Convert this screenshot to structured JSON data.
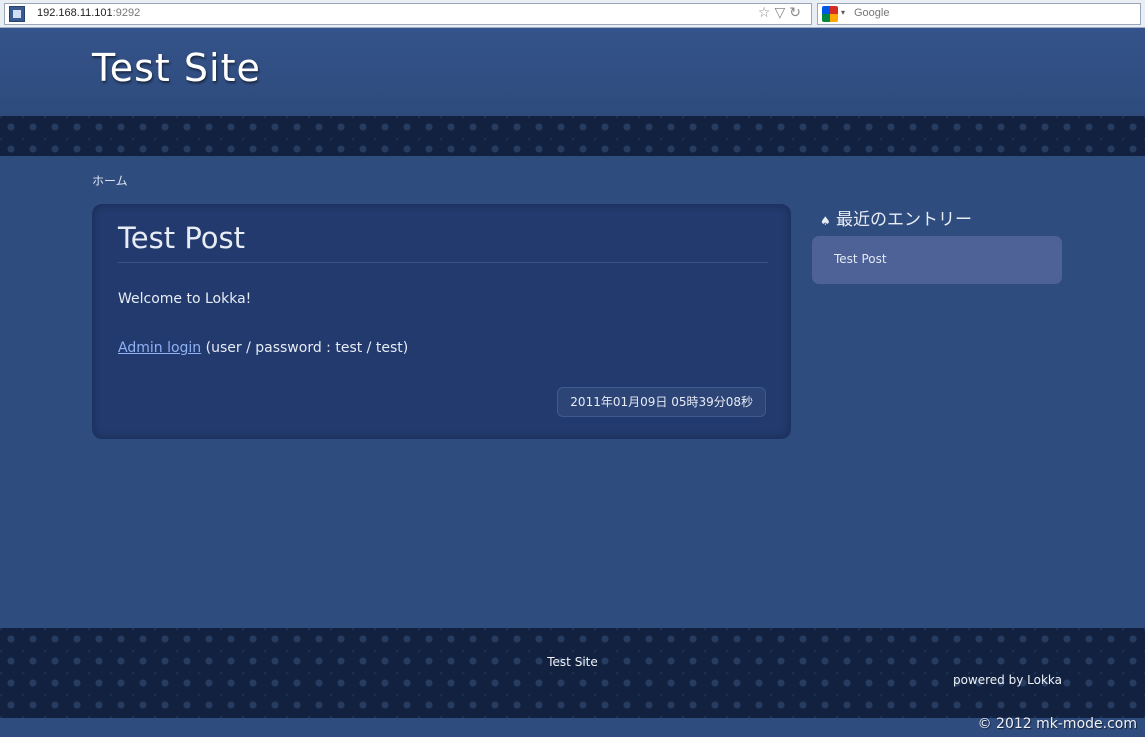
{
  "browser": {
    "url_host": "192.168.11.101",
    "url_port": ":9292",
    "search_placeholder": "Google",
    "star_icon": "☆",
    "dropdown_icon": "▽",
    "reload_icon": "↻",
    "engine_arrow": "▾"
  },
  "header": {
    "site_title": "Test Site"
  },
  "breadcrumb": {
    "home": "ホーム"
  },
  "post": {
    "title": "Test Post",
    "body": "Welcome to Lokka!",
    "login_link": "Admin login",
    "login_note": " (user / password : test / test)",
    "date": "2011年01月09日 05時39分08秒"
  },
  "sidebar": {
    "tree_icon": "♠",
    "heading": "最近のエントリー",
    "items": [
      {
        "label": "Test Post"
      }
    ]
  },
  "footer": {
    "site_title": "Test Site",
    "powered": "powered by Lokka",
    "copyright": "© 2012 mk-mode.com"
  }
}
